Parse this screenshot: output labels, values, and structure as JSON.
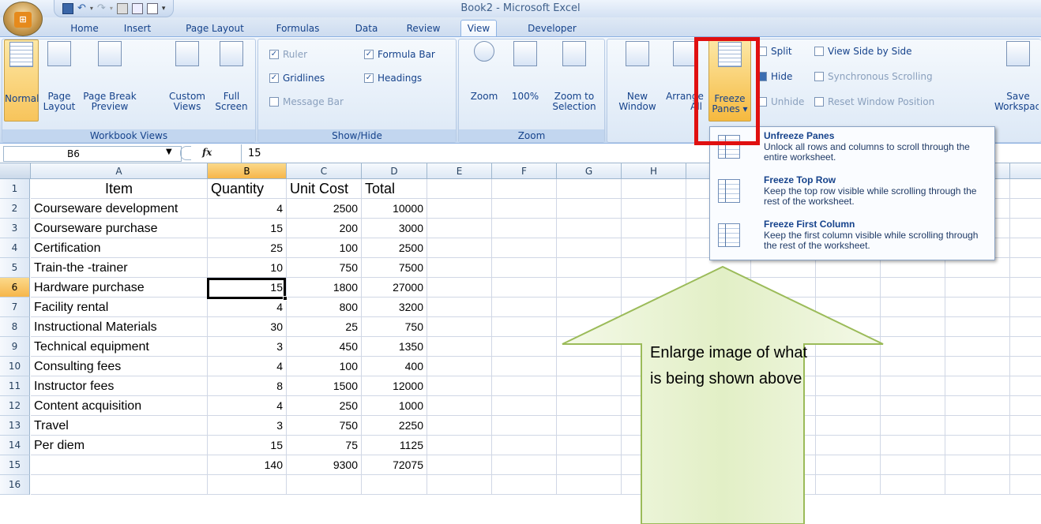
{
  "window": {
    "title": "Book2 - Microsoft Excel"
  },
  "tabs": [
    {
      "label": "Home",
      "active": false
    },
    {
      "label": "Insert",
      "active": false
    },
    {
      "label": "Page Layout",
      "active": false
    },
    {
      "label": "Formulas",
      "active": false
    },
    {
      "label": "Data",
      "active": false
    },
    {
      "label": "Review",
      "active": false
    },
    {
      "label": "View",
      "active": true
    },
    {
      "label": "Developer",
      "active": false
    }
  ],
  "ribbon": {
    "workbook_views": {
      "label": "Workbook Views",
      "normal": "Normal",
      "page_layout_1": "Page",
      "page_layout_2": "Layout",
      "page_break_1": "Page Break",
      "page_break_2": "Preview",
      "custom_views_1": "Custom",
      "custom_views_2": "Views",
      "full_screen_1": "Full",
      "full_screen_2": "Screen"
    },
    "show_hide": {
      "label": "Show/Hide",
      "ruler": "Ruler",
      "gridlines": "Gridlines",
      "message_bar": "Message Bar",
      "formula_bar": "Formula Bar",
      "headings": "Headings"
    },
    "zoom": {
      "label": "Zoom",
      "zoom": "Zoom",
      "hundred": "100%",
      "zoom_sel_1": "Zoom to",
      "zoom_sel_2": "Selection"
    },
    "window": {
      "new_window_1": "New",
      "new_window_2": "Window",
      "arrange_1": "Arrange",
      "arrange_2": "All",
      "freeze_1": "Freeze",
      "freeze_2": "Panes ▾",
      "split": "Split",
      "hide": "Hide",
      "unhide": "Unhide",
      "side_by_side": "View Side by Side",
      "sync_scroll": "Synchronous Scrolling",
      "reset_pos": "Reset Window Position",
      "save_ws_1": "Save",
      "save_ws_2": "Workspace"
    }
  },
  "formula_bar": {
    "name_box": "B6",
    "fx": "fx",
    "value": "15"
  },
  "columns": [
    "A",
    "B",
    "C",
    "D",
    "E",
    "F",
    "G",
    "H"
  ],
  "sheet": {
    "header": [
      "Item",
      "Quantity",
      "Unit Cost",
      "Total"
    ],
    "rows": [
      [
        "Courseware development",
        "4",
        "2500",
        "10000"
      ],
      [
        "Courseware purchase",
        "15",
        "200",
        "3000"
      ],
      [
        "Certification",
        "25",
        "100",
        "2500"
      ],
      [
        "Train-the -trainer",
        "10",
        "750",
        "7500"
      ],
      [
        "Hardware purchase",
        "15",
        "1800",
        "27000"
      ],
      [
        "Facility rental",
        "4",
        "800",
        "3200"
      ],
      [
        "Instructional Materials",
        "30",
        "25",
        "750"
      ],
      [
        "Technical equipment",
        "3",
        "450",
        "1350"
      ],
      [
        "Consulting fees",
        "4",
        "100",
        "400"
      ],
      [
        "Instructor fees",
        "8",
        "1500",
        "12000"
      ],
      [
        "Content acquisition",
        "4",
        "250",
        "1000"
      ],
      [
        "Travel",
        "3",
        "750",
        "2250"
      ],
      [
        "Per diem",
        "15",
        "75",
        "1125"
      ],
      [
        "",
        "140",
        "9300",
        "72075"
      ]
    ],
    "row_numbers": [
      "1",
      "2",
      "3",
      "4",
      "5",
      "6",
      "7",
      "8",
      "9",
      "10",
      "11",
      "12",
      "13",
      "14",
      "15",
      "16"
    ]
  },
  "freeze_menu": {
    "items": [
      {
        "title": "Unfreeze Panes",
        "desc": "Unlock all rows and columns to scroll through the entire worksheet."
      },
      {
        "title": "Freeze Top Row",
        "desc": "Keep the top row visible while scrolling through the rest of the worksheet."
      },
      {
        "title": "Freeze First Column",
        "desc": "Keep the first column visible while scrolling through the rest of the worksheet."
      }
    ]
  },
  "callout": {
    "text": "Enlarge image of what is being shown above"
  },
  "colors": {
    "highlight": "#e01010",
    "arrow_fill": "#e7f3c9",
    "arrow_border": "#9bbb59"
  }
}
